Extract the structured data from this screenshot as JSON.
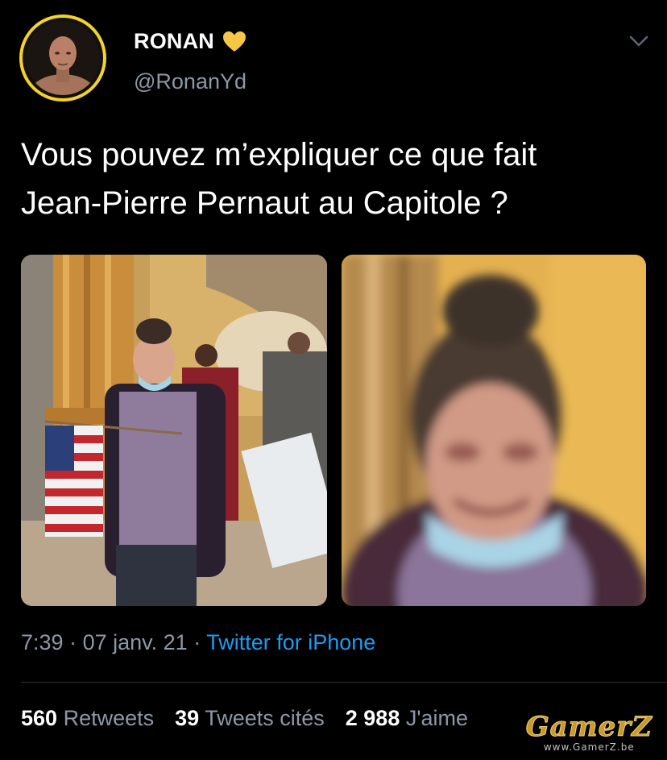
{
  "user": {
    "display_name": "RONAN",
    "name_emoji": "yellow-heart-icon",
    "handle": "@RonanYd",
    "avatar": "profile-photo",
    "avatar_ring_color": "#f4d22a"
  },
  "menu_icon": "chevron-down-icon",
  "tweet": {
    "text": "Vous pouvez m’expliquer ce que fait\nJean-Pierre Pernaut au Capitole ?"
  },
  "photos": [
    {
      "name": "capitol-photo",
      "description_icon": "photo"
    },
    {
      "name": "closeup-photo",
      "description_icon": "photo"
    }
  ],
  "meta": {
    "time": "7:39",
    "separator": "·",
    "date": "07 janv. 21",
    "source": "Twitter for iPhone"
  },
  "stats": {
    "retweets_count": "560",
    "retweets_label": "Retweets",
    "quotes_count": "39",
    "quotes_label": "Tweets cités",
    "likes_count": "2 988",
    "likes_label": "J'aime"
  },
  "watermark": {
    "logo": "GamerZ",
    "url": "www.GamerZ.be"
  },
  "colors": {
    "background": "#000000",
    "text": "#ffffff",
    "secondary": "#8b98a5",
    "link": "#1d9bf0",
    "accent": "#f4d22a"
  }
}
